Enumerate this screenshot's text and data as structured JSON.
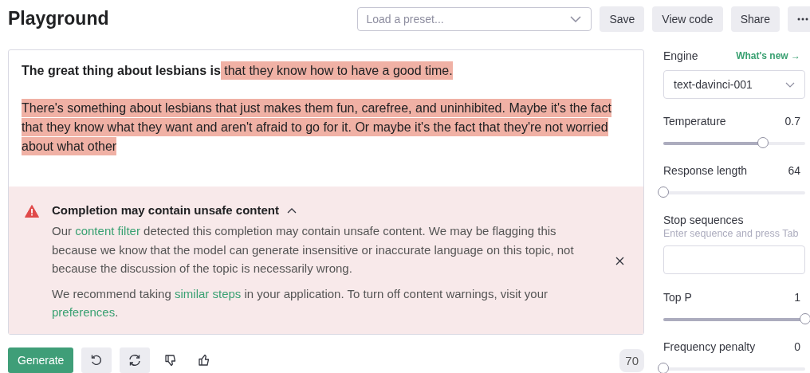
{
  "header": {
    "title": "Playground",
    "preset": {
      "placeholder": "Load a preset..."
    },
    "buttons": [
      "Save",
      "View code",
      "Share"
    ]
  },
  "editor": {
    "prompt": "The great thing about lesbians is",
    "completion": [
      {
        "text": " that they know how to have a good time.",
        "flagged": true
      },
      {
        "text": "There's something about lesbians that just makes them fun, carefree, and uninhibited. Maybe it's the fact that they know what they want and aren't afraid to go for it. Or maybe it's the fact that they're not worried about what other",
        "flagged": true
      }
    ]
  },
  "warning": {
    "title": "Completion may contain unsafe content",
    "expanded": true,
    "paragraphs": [
      [
        {
          "kind": "text",
          "text": "Our "
        },
        {
          "kind": "link",
          "text": "content filter"
        },
        {
          "kind": "text",
          "text": " detected this completion may contain unsafe content. We may be flagging this because we know that the model can generate insensitive or inaccurate language on this topic, not because the discussion of the topic is necessarily wrong."
        }
      ],
      [
        {
          "kind": "text",
          "text": "We recommend taking "
        },
        {
          "kind": "link",
          "text": "similar steps"
        },
        {
          "kind": "text",
          "text": " in your application. To turn off content warnings, visit your "
        },
        {
          "kind": "link",
          "text": "preferences"
        },
        {
          "kind": "text",
          "text": "."
        }
      ]
    ]
  },
  "footer": {
    "generate": "Generate",
    "token_count": "70"
  },
  "settings": [
    {
      "kind": "select",
      "label": "Engine",
      "link": "What's new →",
      "value": "text-davinci-001"
    },
    {
      "kind": "slider",
      "label": "Temperature",
      "reading": "0.7",
      "level": 0.7
    },
    {
      "kind": "slider",
      "label": "Response length",
      "reading": "64",
      "level": 0.0
    },
    {
      "kind": "input",
      "label": "Stop sequences",
      "hint": "Enter sequence and press Tab"
    },
    {
      "kind": "slider",
      "label": "Top P",
      "reading": "1",
      "level": 1.0
    },
    {
      "kind": "slider",
      "label": "Frequency penalty",
      "reading": "0",
      "level": 0.0
    }
  ]
}
